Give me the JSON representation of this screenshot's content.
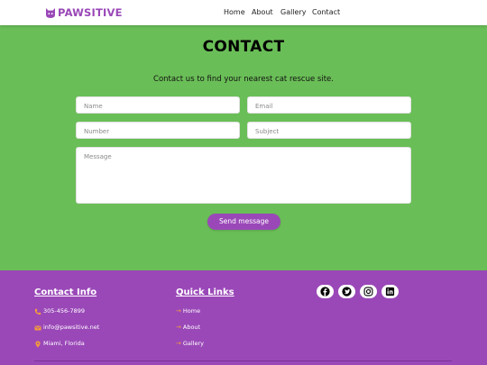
{
  "header": {
    "brand": "PAWSITIVE",
    "brand_icon": "cat-icon",
    "brand_color": "#9a48b8",
    "nav": [
      "Home",
      "About",
      "Gallery",
      "Contact"
    ]
  },
  "contact": {
    "title": "CONTACT",
    "subtitle": "Contact us to find your nearest cat rescue site.",
    "fields": {
      "name": {
        "placeholder": "Name",
        "value": ""
      },
      "email": {
        "placeholder": "Email",
        "value": ""
      },
      "number": {
        "placeholder": "Number",
        "value": ""
      },
      "subject": {
        "placeholder": "Subject",
        "value": ""
      },
      "message": {
        "placeholder": "Message",
        "value": ""
      }
    },
    "send_label": "Send message"
  },
  "footer": {
    "contact_title": "Contact Info",
    "phone": "305-456-7899",
    "email": "info@pawsitive.net",
    "location": "Miami, Florida",
    "links_title": "Quick Links",
    "links": [
      "Home",
      "About",
      "Gallery"
    ],
    "socials": [
      "facebook-icon",
      "twitter-icon",
      "instagram-icon",
      "linkedin-icon"
    ],
    "accent_color": "#f39a3e"
  },
  "colors": {
    "page_background": "#6abe57",
    "footer_background": "#9a48b8",
    "button": "#9a48b8"
  }
}
